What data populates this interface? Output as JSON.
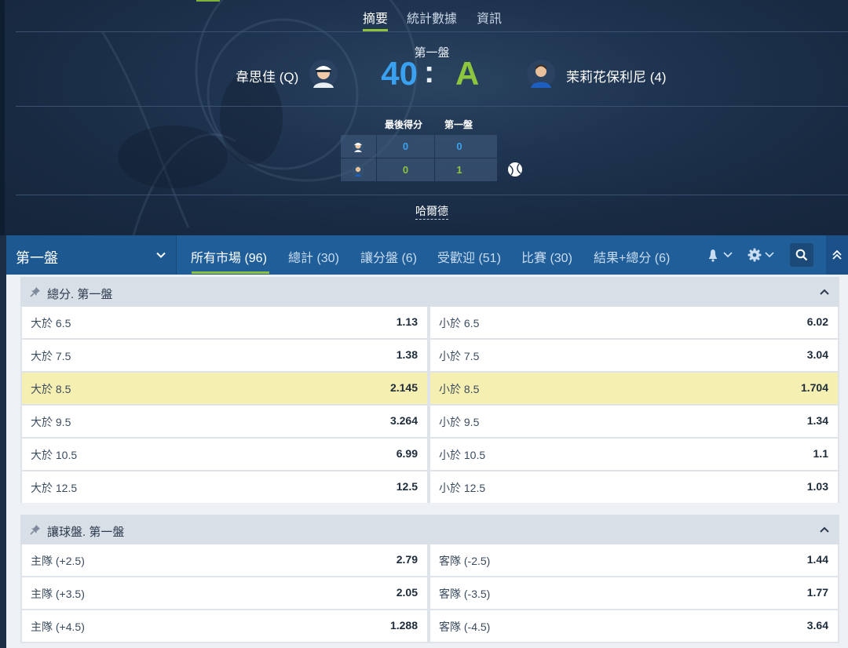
{
  "header": {
    "tabs": [
      {
        "label": "摘要",
        "active": true
      },
      {
        "label": "統計數據",
        "active": false
      },
      {
        "label": "資訊",
        "active": false
      }
    ],
    "set_label": "第一盤",
    "home": {
      "name": "韋思佳 (Q)",
      "score": "40",
      "last_points": "0",
      "set1": "0"
    },
    "away": {
      "name": "茉莉花保利尼 (4)",
      "score": "A",
      "last_points": "0",
      "set1": "1"
    },
    "score_separator": ":",
    "scoreboard_headers": {
      "last_points": "最後得分",
      "set1": "第一盤"
    },
    "serving": "away",
    "venue": "哈爾德",
    "colors": {
      "home": "#3aa0f0",
      "away": "#8cc63f",
      "accent": "#8fc23a"
    }
  },
  "nav": {
    "period_select": "第一盤",
    "tabs": [
      {
        "label": "所有市場 (96)",
        "active": true
      },
      {
        "label": "總計 (30)",
        "active": false
      },
      {
        "label": "讓分盤 (6)",
        "active": false
      },
      {
        "label": "受歡迎 (51)",
        "active": false
      },
      {
        "label": "比賽 (30)",
        "active": false
      },
      {
        "label": "結果+總分 (6)",
        "active": false
      }
    ],
    "icons": [
      "bell-icon",
      "gear-icon",
      "search-icon",
      "double-chevron-up-icon"
    ]
  },
  "markets": [
    {
      "title": "總分. 第一盤",
      "rows": [
        {
          "left_label": "大於 6.5",
          "left_odds": "1.13",
          "right_label": "小於 6.5",
          "right_odds": "6.02",
          "highlighted": false
        },
        {
          "left_label": "大於 7.5",
          "left_odds": "1.38",
          "right_label": "小於 7.5",
          "right_odds": "3.04",
          "highlighted": false
        },
        {
          "left_label": "大於 8.5",
          "left_odds": "2.145",
          "right_label": "小於 8.5",
          "right_odds": "1.704",
          "highlighted": true
        },
        {
          "left_label": "大於 9.5",
          "left_odds": "3.264",
          "right_label": "小於 9.5",
          "right_odds": "1.34",
          "highlighted": false
        },
        {
          "left_label": "大於 10.5",
          "left_odds": "6.99",
          "right_label": "小於 10.5",
          "right_odds": "1.1",
          "highlighted": false
        },
        {
          "left_label": "大於 12.5",
          "left_odds": "12.5",
          "right_label": "小於 12.5",
          "right_odds": "1.03",
          "highlighted": false
        }
      ]
    },
    {
      "title": "讓球盤. 第一盤",
      "rows": [
        {
          "left_label": "主隊 (+2.5)",
          "left_odds": "2.79",
          "right_label": "客隊 (-2.5)",
          "right_odds": "1.44",
          "highlighted": false
        },
        {
          "left_label": "主隊 (+3.5)",
          "left_odds": "2.05",
          "right_label": "客隊 (-3.5)",
          "right_odds": "1.77",
          "highlighted": false
        },
        {
          "left_label": "主隊 (+4.5)",
          "left_odds": "1.288",
          "right_label": "客隊 (-4.5)",
          "right_odds": "3.64",
          "highlighted": false
        }
      ]
    }
  ]
}
